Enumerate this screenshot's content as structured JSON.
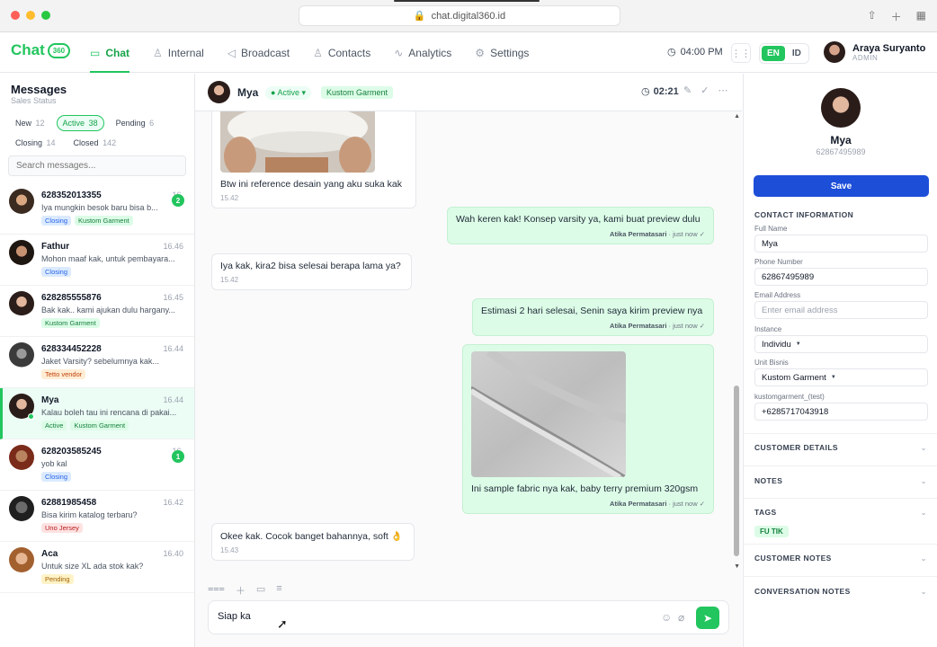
{
  "browser": {
    "url": "chat.digital360.id"
  },
  "header": {
    "logo_text": "Chat",
    "logo_badge": "360",
    "nav": [
      {
        "label": "Chat",
        "icon": "chat-icon",
        "active": true
      },
      {
        "label": "Internal",
        "icon": "user-icon"
      },
      {
        "label": "Broadcast",
        "icon": "send-icon"
      },
      {
        "label": "Contacts",
        "icon": "user-icon"
      },
      {
        "label": "Analytics",
        "icon": "activity-icon"
      },
      {
        "label": "Settings",
        "icon": "gear-icon"
      }
    ],
    "time": "04:00 PM",
    "lang_active": "EN",
    "lang_other": "ID",
    "user_name": "Araya Suryanto",
    "user_role": "ADMIN"
  },
  "sidebar": {
    "title": "Messages",
    "subtitle": "Sales Status",
    "filters": [
      {
        "label": "New",
        "count": "12"
      },
      {
        "label": "Active",
        "count": "38",
        "active": true
      },
      {
        "label": "Pending",
        "count": "6"
      },
      {
        "label": "Closing",
        "count": "14"
      },
      {
        "label": "Closed",
        "count": "142"
      }
    ],
    "search_placeholder": "Search messages...",
    "conversations": [
      {
        "name": "628352013355",
        "time": "16.",
        "preview": "Iya mungkin besok baru bisa b...",
        "tags": [
          {
            "t": "Closing",
            "c": "blue"
          },
          {
            "t": "Kustom Garment",
            "c": "green"
          }
        ],
        "unread": "2"
      },
      {
        "name": "Fathur",
        "time": "16.46",
        "preview": "Mohon maaf kak, untuk pembayara...",
        "tags": [
          {
            "t": "Closing",
            "c": "blue"
          }
        ]
      },
      {
        "name": "628285555876",
        "time": "16.45",
        "preview": "Bak kak.. kami ajukan dulu hargany...",
        "tags": [
          {
            "t": "Kustom Garment",
            "c": "green"
          }
        ]
      },
      {
        "name": "628334452228",
        "time": "16.44",
        "preview": "Jaket Varsity? sebelumnya kak...",
        "tags": [
          {
            "t": "Tetto vendor",
            "c": "orange"
          }
        ]
      },
      {
        "name": "Mya",
        "time": "16.44",
        "preview": "Kalau boleh tau ini rencana di pakai...",
        "tags": [
          {
            "t": "Active",
            "c": "green"
          },
          {
            "t": "Kustom Garment",
            "c": "green"
          }
        ],
        "selected": true
      },
      {
        "name": "628203585245",
        "time": "16.",
        "preview": "yob kal",
        "tags": [
          {
            "t": "Closing",
            "c": "blue"
          }
        ],
        "unread": "1"
      },
      {
        "name": "62881985458",
        "time": "16.42",
        "preview": "Bisa kirim katalog terbaru?",
        "tags": [
          {
            "t": "Uno Jersey",
            "c": "red"
          }
        ]
      },
      {
        "name": "Aca",
        "time": "16.40",
        "preview": "Untuk size XL ada stok kak?",
        "tags": [
          {
            "t": "Pending",
            "c": "yellow"
          }
        ]
      }
    ]
  },
  "chat": {
    "contact_name": "Mya",
    "status": "Active",
    "tag": "Kustom Garment",
    "timer": "02:21",
    "messages": [
      {
        "dir": "in",
        "text": "Btw ini reference desain yang aku suka kak",
        "time": "15.42",
        "image": "white-cap-photo"
      },
      {
        "dir": "out",
        "text": "Wah keren kak! Konsep varsity ya, kami buat preview dulu",
        "agent": "Atika Permatasari",
        "when": "just now"
      },
      {
        "dir": "in",
        "text": "Iya kak, kira2 bisa selesai berapa lama ya?",
        "time": "15.42"
      },
      {
        "dir": "out",
        "text": "Estimasi 2 hari selesai, Senin saya kirim preview nya",
        "agent": "Atika Permatasari",
        "when": "just now"
      },
      {
        "dir": "out",
        "text": "Ini sample fabric nya kak, baby terry premium 320gsm",
        "agent": "Atika Permatasari",
        "when": "just now",
        "image": "grey-fabric-photo"
      },
      {
        "dir": "in",
        "text": "Okee kak. Cocok banget bahannya, soft 👌",
        "time": "15.43"
      }
    ],
    "composer_value": "Siap ka"
  },
  "contact": {
    "name": "Mya",
    "phone": "62867495989",
    "save_label": "Save",
    "section_title": "CONTACT INFORMATION",
    "fields": [
      {
        "label": "Full Name",
        "value": "Mya"
      },
      {
        "label": "Phone Number",
        "value": "62867495989"
      },
      {
        "label": "Email Address",
        "placeholder": "Enter email address"
      },
      {
        "label": "Instance",
        "value": "Individu"
      },
      {
        "label": "Unit Bisnis",
        "value": "Kustom Garment"
      },
      {
        "label": "kustomgarment_(test)",
        "value": "+6285717043918"
      }
    ],
    "sections": [
      "CUSTOMER DETAILS",
      "NOTES",
      "TAGS",
      "CUSTOMER NOTES",
      "CONVERSATION NOTES"
    ],
    "tags": [
      "FU TIK"
    ]
  },
  "colors": {
    "accent": "#22c55e",
    "primary_button": "#1d4ed8",
    "outgoing_bubble": "#dcfce7"
  }
}
